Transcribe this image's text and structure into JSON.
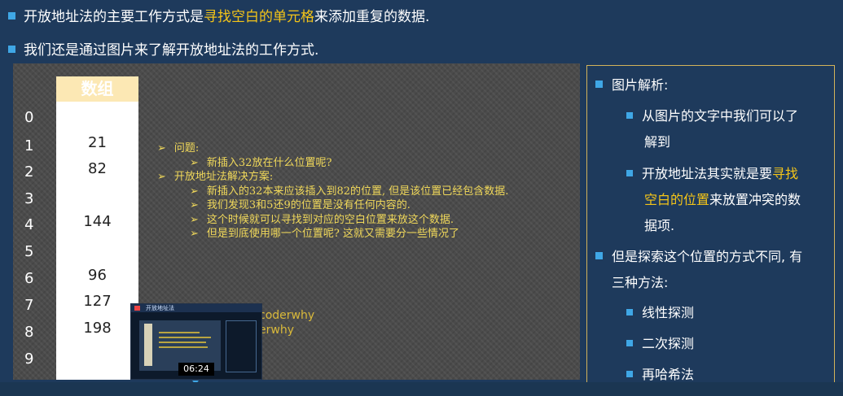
{
  "top_bullets": [
    {
      "pre": "开放地址法的主要工作方式是",
      "highlight": "寻找空白的单元格",
      "post": "来添加重复的数据."
    },
    {
      "text": "我们还是通过图片来了解开放地址法的工作方式."
    }
  ],
  "array_figure": {
    "header": "数组",
    "indices": [
      "0",
      "1",
      "2",
      "3",
      "4",
      "5",
      "6",
      "7",
      "8",
      "9"
    ],
    "values": [
      "",
      "21",
      "82",
      "",
      "144",
      "",
      "96",
      "127",
      "198",
      ""
    ]
  },
  "notes": {
    "bullet_glyph": "➢",
    "q_title": "问题:",
    "q_items": [
      "新插入32放在什么位置呢?"
    ],
    "s_title": "开放地址法解决方案:",
    "s_items": [
      "新插入的32本来应该插入到82的位置, 但是该位置已经包含数据.",
      "我们发现3和5还9的位置是没有任何内容的.",
      "这个时候就可以寻找到对应的空白位置来放这个数据.",
      "但是到底使用哪一个位置呢? 这就又需要分一些情况了"
    ]
  },
  "watermark": {
    "line1": "coderwhy",
    "line2": "erwhy"
  },
  "video_thumb": {
    "title": "开放地址法",
    "time": "06:24"
  },
  "right_panel": {
    "title": "图片解析:",
    "sub1_line1": "从图片的文字中我们可以了",
    "sub1_line2": "解到",
    "sub2_pre": "开放地址法其实就是要",
    "sub2_hl1": "寻找",
    "sub2_hl2": "空白的位置",
    "sub2_post": "来放置冲突的数",
    "sub2_line3": "据项.",
    "item2_line1": "但是探索这个位置的方式不同, 有",
    "item2_line2": "三种方法:",
    "methods": [
      "线性探测",
      "二次探测",
      "再哈希法"
    ]
  },
  "colors": {
    "accent": "#f5c518",
    "bullet": "#3fa7e6",
    "background": "#1e3a5c"
  }
}
